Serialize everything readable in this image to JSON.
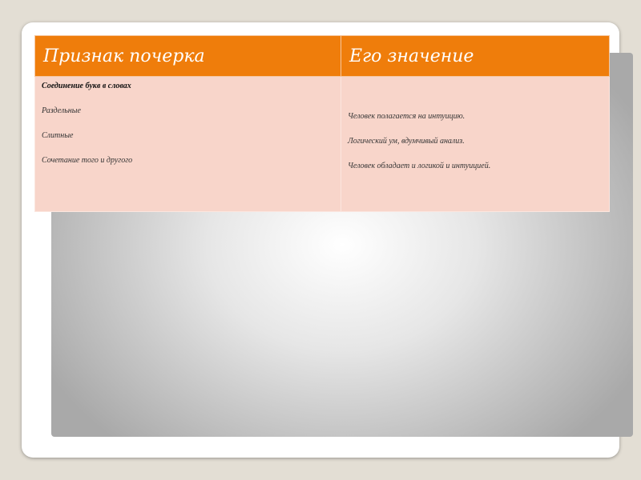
{
  "table": {
    "headers": [
      "Признак почерка",
      "Его значение"
    ],
    "left": {
      "title": "Соединение букв в словах",
      "items": [
        "Раздельные",
        "Слитные",
        "Сочетание того и другого"
      ]
    },
    "right": {
      "items": [
        "Человек полагается на интуицию.",
        "Логический ум, вдумчивый анализ.",
        "Человек обладает и логикой и интуицией."
      ]
    }
  },
  "colors": {
    "header": "#ef7d0b",
    "cell": "#f8d5ca",
    "background": "#e3ded4"
  }
}
